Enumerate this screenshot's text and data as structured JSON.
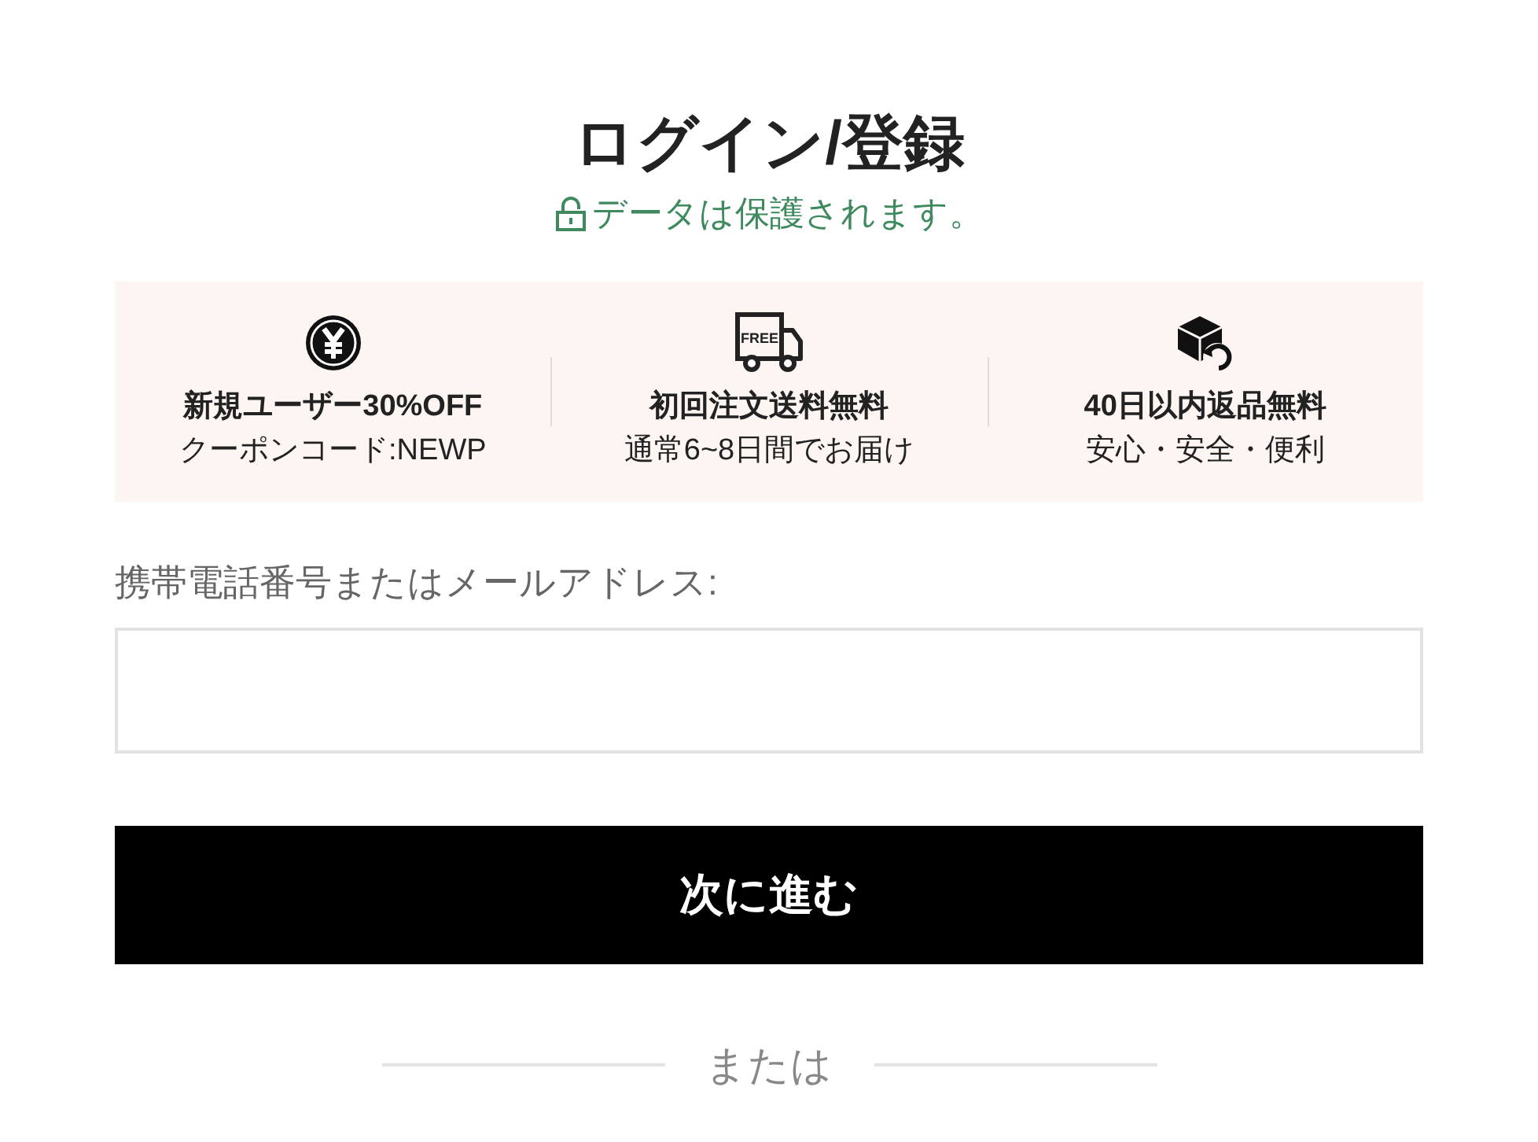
{
  "title": "ログイン/登録",
  "security_note": "データは保護されます。",
  "benefits": [
    {
      "kind": "yen",
      "heading": "新規ユーザー30%OFF",
      "detail": "クーポンコード:NEWP"
    },
    {
      "kind": "truck",
      "icon_text": "FREE",
      "heading": "初回注文送料無料",
      "detail": "通常6~8日間でお届け"
    },
    {
      "kind": "return",
      "heading": "40日以内返品無料",
      "detail": "安心・安全・便利"
    }
  ],
  "login_field": {
    "label": "携帯電話番号またはメールアドレス:"
  },
  "next_button": "次に進む",
  "divider": "または"
}
